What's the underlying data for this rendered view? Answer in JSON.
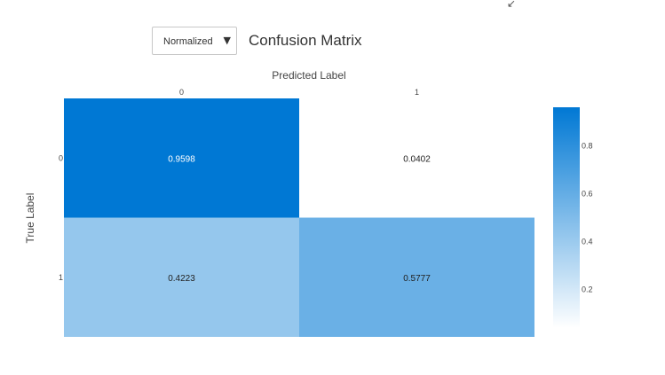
{
  "window": {
    "resize_icon": "↙"
  },
  "controls": {
    "normalization_select": {
      "value": "Normalized",
      "caret": "▼"
    }
  },
  "chart_data": {
    "type": "heatmap",
    "title": "Confusion Matrix",
    "xlabel": "Predicted Label",
    "ylabel": "True Label",
    "x_categories": [
      "0",
      "1"
    ],
    "y_categories": [
      "0",
      "1"
    ],
    "values": [
      [
        0.9598,
        0.0402
      ],
      [
        0.4223,
        0.5777
      ]
    ],
    "cell_labels": [
      [
        "0.9598",
        "0.0402"
      ],
      [
        "0.4223",
        "0.5777"
      ]
    ],
    "colorscale": {
      "low": "#ffffff",
      "high": "#0078d4"
    },
    "colorbar": {
      "range": [
        0.0402,
        0.9598
      ],
      "tick_values": [
        0.2,
        0.4,
        0.6,
        0.8
      ],
      "tick_labels": [
        "0.2",
        "0.4",
        "0.6",
        "0.8"
      ]
    },
    "legend": "colorbar-right",
    "grid": false
  }
}
